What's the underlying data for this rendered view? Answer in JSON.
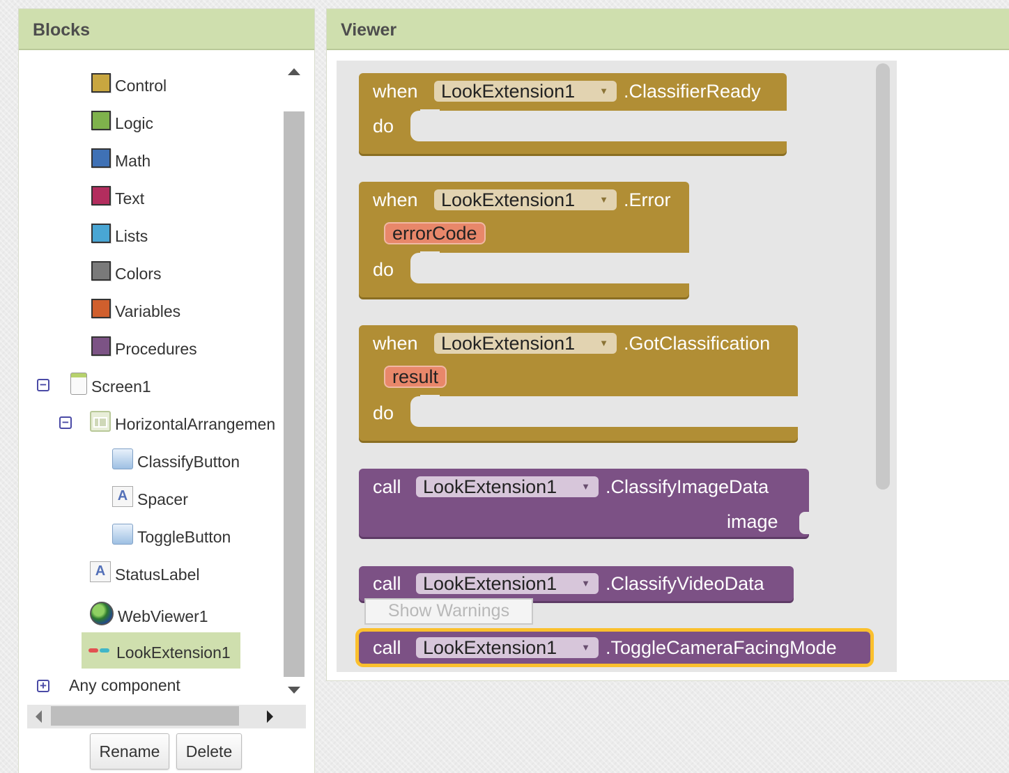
{
  "blocks_panel": {
    "title": "Blocks",
    "builtin": [
      {
        "label": "Control",
        "color": "#c8a640"
      },
      {
        "label": "Logic",
        "color": "#7fb24c"
      },
      {
        "label": "Math",
        "color": "#3f71b5"
      },
      {
        "label": "Text",
        "color": "#b32d5e"
      },
      {
        "label": "Lists",
        "color": "#49a6d4"
      },
      {
        "label": "Colors",
        "color": "#7a7a7a"
      },
      {
        "label": "Variables",
        "color": "#d05f2d"
      },
      {
        "label": "Procedures",
        "color": "#7c5385"
      }
    ],
    "components": {
      "screen": "Screen1",
      "arrangement": "HorizontalArrangemen",
      "children": [
        "ClassifyButton",
        "Spacer",
        "ToggleButton"
      ],
      "status_label": "StatusLabel",
      "webviewer": "WebViewer1",
      "extension": "LookExtension1"
    },
    "any_component": "Any component",
    "rename_label": "Rename",
    "delete_label": "Delete"
  },
  "viewer": {
    "title": "Viewer",
    "show_warnings": "Show Warnings",
    "blocks": [
      {
        "kind": "event",
        "prefix": "when",
        "component": "LookExtension1",
        "member": ".ClassifierReady",
        "do": "do"
      },
      {
        "kind": "event",
        "prefix": "when",
        "component": "LookExtension1",
        "member": ".Error",
        "param": "errorCode",
        "do": "do"
      },
      {
        "kind": "event",
        "prefix": "when",
        "component": "LookExtension1",
        "member": ".GotClassification",
        "param": "result",
        "do": "do"
      },
      {
        "kind": "method",
        "prefix": "call",
        "component": "LookExtension1",
        "member": ".ClassifyImageData",
        "arg": "image"
      },
      {
        "kind": "method",
        "prefix": "call",
        "component": "LookExtension1",
        "member": ".ClassifyVideoData"
      },
      {
        "kind": "method",
        "prefix": "call",
        "component": "LookExtension1",
        "member": ".ToggleCameraFacingMode",
        "selected": true
      }
    ],
    "dropdown_glyph": "▼"
  },
  "colors": {
    "header_bg": "#cfdfae",
    "event_block": "#b18e35",
    "method_block": "#7c5185",
    "param_block": "#e8876a",
    "selection": "#fbc02d"
  }
}
